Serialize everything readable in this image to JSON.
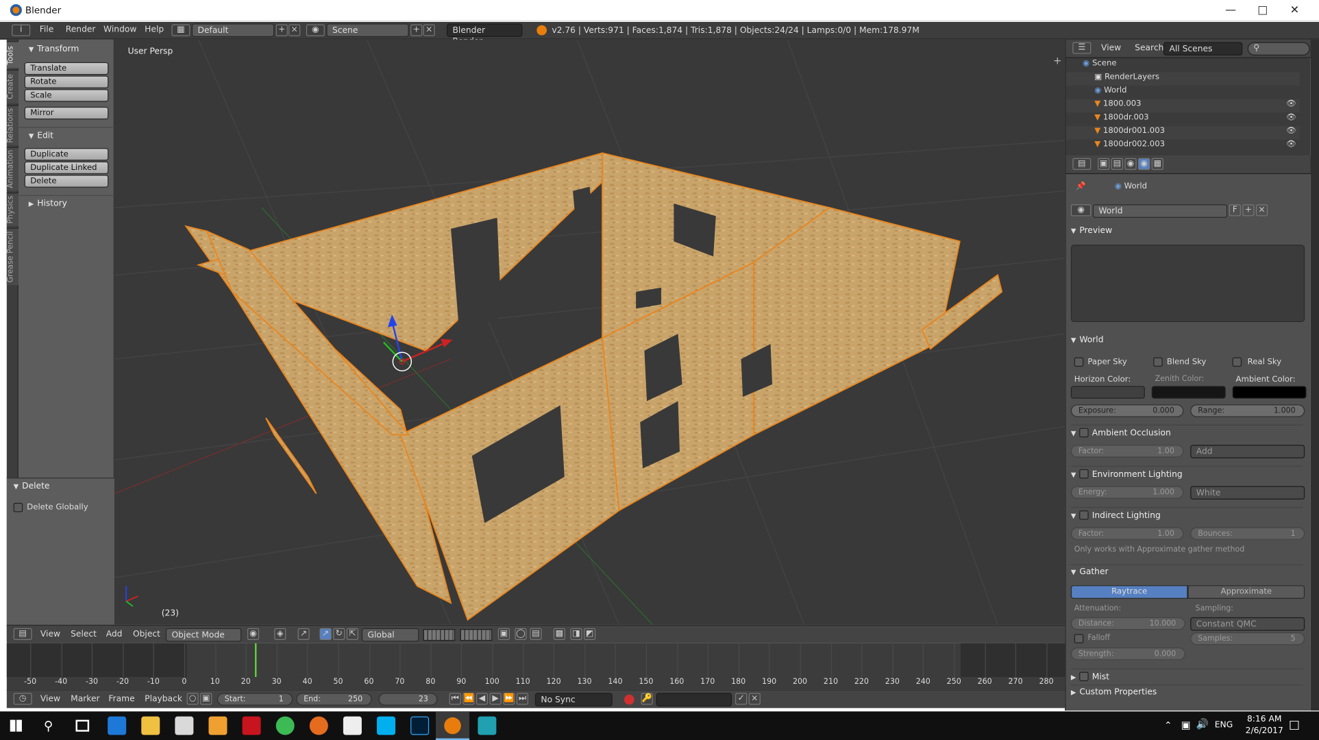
{
  "window": {
    "title": "Blender"
  },
  "menu": {
    "items": [
      "File",
      "Render",
      "Window",
      "Help"
    ],
    "layout": "Default",
    "scene": "Scene",
    "engine": "Blender Render",
    "stats": "v2.76 | Verts:971 | Faces:1,874 | Tris:1,878 | Objects:24/24 | Lamps:0/0 | Mem:178.97M"
  },
  "left_tabs": [
    "Tools",
    "Create",
    "Relations",
    "Animation",
    "Physics",
    "Grease Pencil"
  ],
  "toolshelf": {
    "transform_title": "Transform",
    "translate": "Translate",
    "rotate": "Rotate",
    "scale": "Scale",
    "mirror": "Mirror",
    "edit_title": "Edit",
    "duplicate": "Duplicate",
    "duplicate_linked": "Duplicate Linked",
    "delete": "Delete",
    "history_title": "History",
    "op_title": "Delete",
    "delete_globally": "Delete Globally"
  },
  "viewport": {
    "label": "User Persp",
    "frame": "(23)"
  },
  "vp_header": {
    "menus": [
      "View",
      "Select",
      "Add",
      "Object"
    ],
    "mode": "Object Mode",
    "orientation": "Global"
  },
  "timeline": {
    "ticks": [
      "-50",
      "-40",
      "-30",
      "-20",
      "-10",
      "0",
      "10",
      "20",
      "30",
      "40",
      "50",
      "60",
      "70",
      "80",
      "90",
      "100",
      "110",
      "120",
      "130",
      "140",
      "150",
      "160",
      "170",
      "180",
      "190",
      "200",
      "210",
      "220",
      "230",
      "240",
      "250",
      "260",
      "270",
      "280"
    ],
    "current_frame_value": 23
  },
  "tl_footer": {
    "menus": [
      "View",
      "Marker",
      "Frame",
      "Playback"
    ],
    "start_label": "Start:",
    "start": "1",
    "end_label": "End:",
    "end": "250",
    "current": "23",
    "sync": "No Sync"
  },
  "outliner": {
    "menus": [
      "View",
      "Search"
    ],
    "filter": "All Scenes",
    "items": [
      "Scene",
      "RenderLayers",
      "World",
      "1800.003",
      "1800dr.003",
      "1800dr001.003",
      "1800dr002.003"
    ]
  },
  "properties": {
    "context": "World",
    "datablock": "World",
    "fake_user": "F",
    "preview_title": "Preview",
    "world_title": "World",
    "paper_sky": "Paper Sky",
    "blend_sky": "Blend Sky",
    "real_sky": "Real Sky",
    "horizon_color": "Horizon Color:",
    "zenith_color": "Zenith Color:",
    "ambient_color": "Ambient Color:",
    "exposure": "Exposure:",
    "exposure_val": "0.000",
    "range": "Range:",
    "range_val": "1.000",
    "ao_title": "Ambient Occlusion",
    "ao_factor": "Factor:",
    "ao_factor_val": "1.00",
    "ao_blend": "Add",
    "env_title": "Environment Lighting",
    "env_energy": "Energy:",
    "env_energy_val": "1.000",
    "env_color": "White",
    "ind_title": "Indirect Lighting",
    "ind_factor": "Factor:",
    "ind_factor_val": "1.00",
    "ind_bounces": "Bounces:",
    "ind_bounces_val": "1",
    "ind_note": "Only works with Approximate gather method",
    "gather_title": "Gather",
    "raytrace": "Raytrace",
    "approximate": "Approximate",
    "attenuation": "Attenuation:",
    "sampling": "Sampling:",
    "distance": "Distance:",
    "distance_val": "10.000",
    "sampling_method": "Constant QMC",
    "falloff": "Falloff",
    "samples": "Samples:",
    "samples_val": "5",
    "strength": "Strength:",
    "strength_val": "0.000",
    "mist_title": "Mist",
    "custom_title": "Custom Properties"
  },
  "taskbar": {
    "lang": "ENG",
    "time": "8:16 AM",
    "date": "2/6/2017"
  },
  "colors": {
    "wood": "#c9a46a",
    "selection": "#e8861f",
    "panel": "#505050",
    "viewport_bg": "#393939",
    "active_blue": "#5680c2"
  }
}
